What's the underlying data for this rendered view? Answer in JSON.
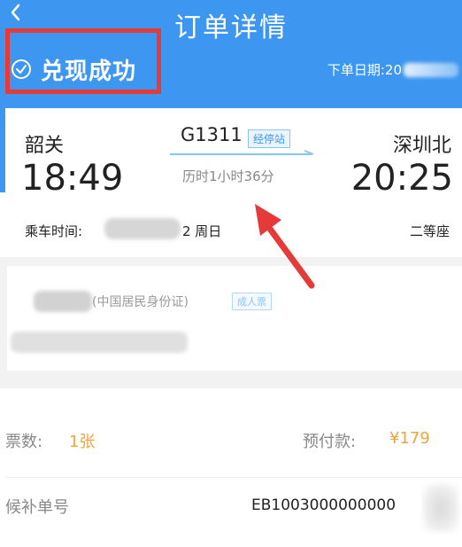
{
  "header": {
    "title": "订单详情",
    "status": "兑现成功",
    "order_date_label": "下单日期:20",
    "back_icon": "chevron-left-icon",
    "status_icon": "check-circle-icon"
  },
  "trip": {
    "from_station": "韶关",
    "from_time": "18:49",
    "to_station": "深圳北",
    "to_time": "20:25",
    "train_no": "G1311",
    "via_badge": "经停站",
    "duration": "历时1小时36分",
    "ride_time_label": "乘车时间:",
    "ride_day": "2 周日",
    "seat_class": "二等座"
  },
  "passenger": {
    "id_type": "(中国居民身份证)",
    "ticket_type": "成人票"
  },
  "ticket_info": {
    "count_label": "票数:",
    "count_value": "1张",
    "prepay_label": "预付款:",
    "prepay_value": "¥179",
    "waitlist_label": "候补单号",
    "waitlist_value": "EB1003000000000"
  },
  "colors": {
    "header_bg": "#3d96f0",
    "highlight": "#e43a3a",
    "price_orange": "#f2a33a"
  }
}
